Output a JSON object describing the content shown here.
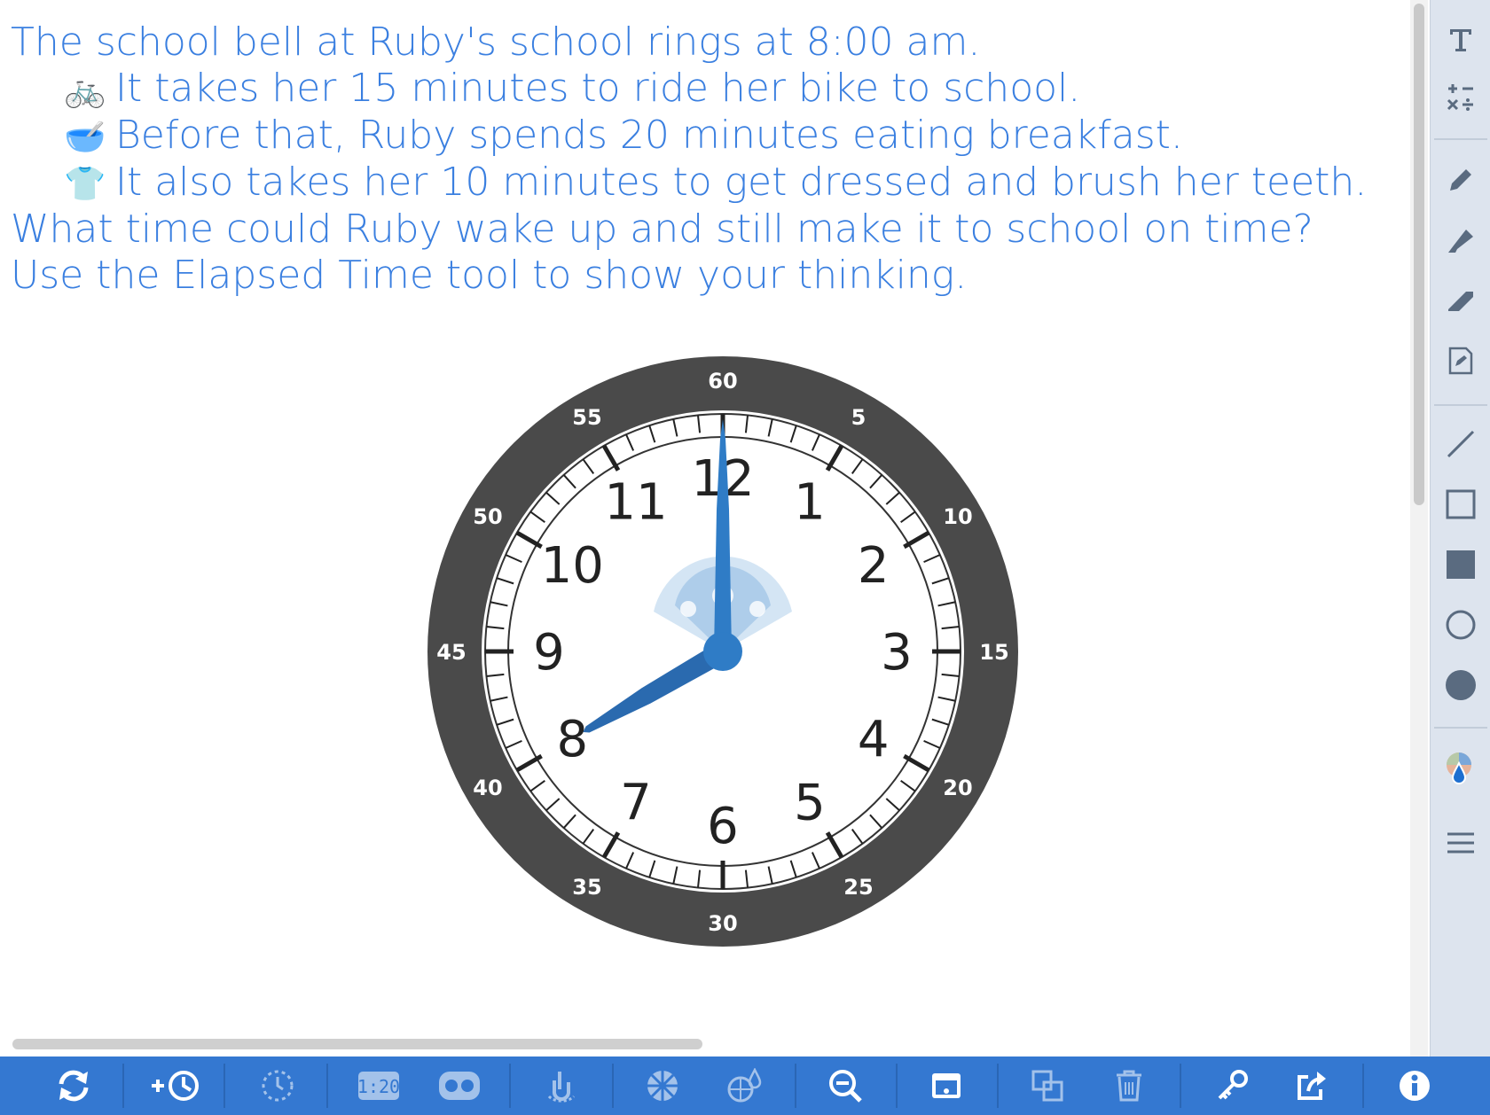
{
  "prompt": {
    "line1": "The school bell at Ruby's school rings at 8:00 am.",
    "line2": "It takes her 15 minutes to ride her bike to school.",
    "line3": "Before that, Ruby spends 20 minutes eating breakfast.",
    "line4": "It also takes her 10 minutes to get dressed and brush her teeth.",
    "line5": "What time could Ruby wake up and still make it to school on time?",
    "line6": "Use the Elapsed Time tool to show your thinking.",
    "emoji_bike": "🚲",
    "emoji_bowl": "🥣",
    "emoji_shirt": "👕"
  },
  "clock": {
    "time_shown": "8:00",
    "hour_numbers": [
      "12",
      "1",
      "2",
      "3",
      "4",
      "5",
      "6",
      "7",
      "8",
      "9",
      "10",
      "11"
    ],
    "minute_labels": [
      "60",
      "5",
      "10",
      "15",
      "20",
      "25",
      "30",
      "35",
      "40",
      "45",
      "50",
      "55"
    ],
    "hand_color": "#2f7cc6",
    "hour_hand_color": "#2a6aaf",
    "bezel_color": "#4a4a4a"
  },
  "sidebar": {
    "icons": [
      "text-icon",
      "math-symbols-icon",
      "pen-icon",
      "highlighter-icon",
      "eraser-icon",
      "note-icon",
      "line-icon",
      "rectangle-outline-icon",
      "rectangle-filled-icon",
      "circle-outline-icon",
      "circle-filled-icon",
      "color-picker-icon",
      "menu-icon"
    ]
  },
  "toolbar": {
    "digital_readout": "1:20",
    "icons": [
      "reset-icon",
      "add-clock-icon",
      "elapsed-time-icon",
      "digital-clock-icon",
      "toggle-view-icon",
      "hand-tool-icon",
      "fraction-icon",
      "color-icon",
      "zoom-out-icon",
      "window-icon",
      "duplicate-icon",
      "trash-icon",
      "key-icon",
      "share-icon",
      "info-icon"
    ]
  },
  "colors": {
    "prompt_text": "#3a7fe0",
    "toolbar_bg": "#3478d1",
    "sidebar_bg": "#dde4ee"
  }
}
